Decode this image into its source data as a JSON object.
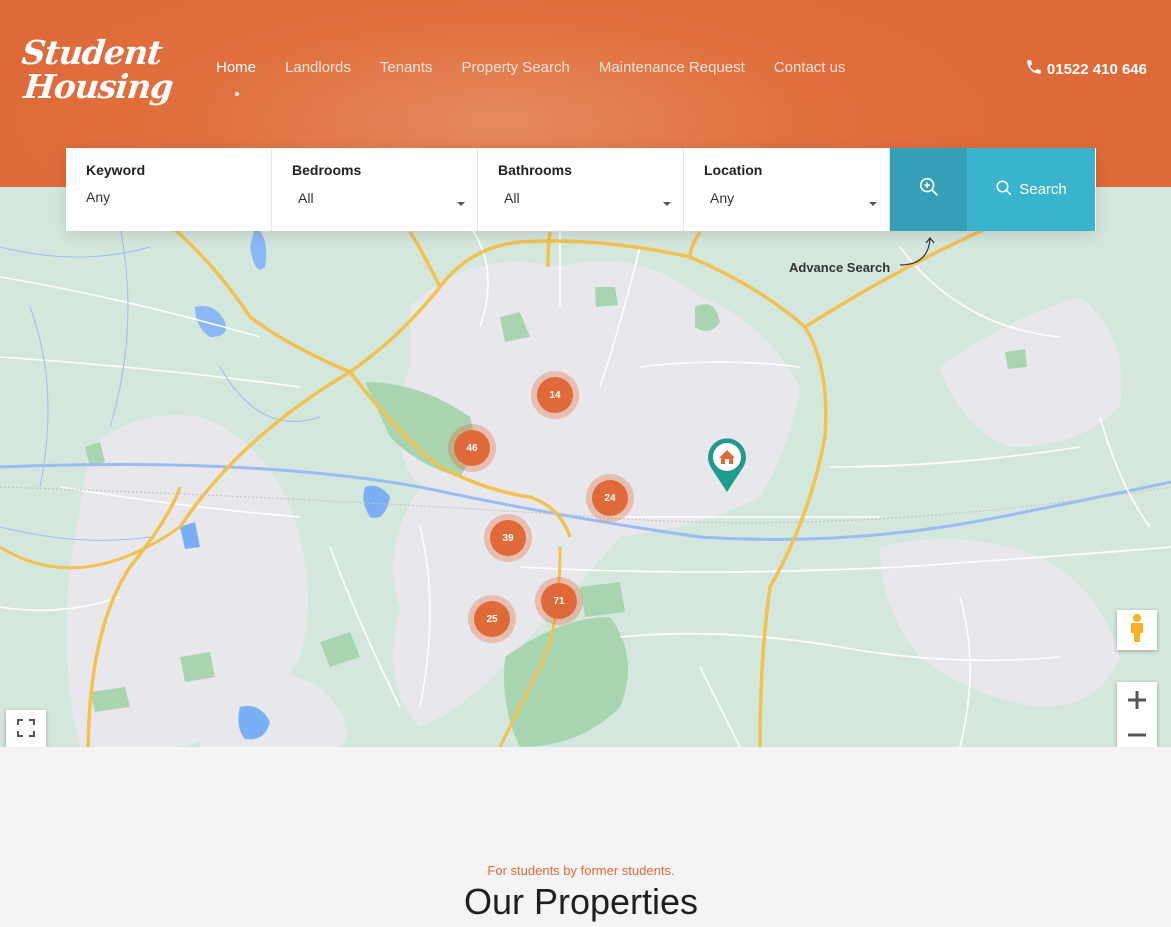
{
  "brand": {
    "line1": "Student",
    "line2": "Housing",
    "color": "#e0693a"
  },
  "nav": {
    "items": [
      "Home",
      "Landlords",
      "Tenants",
      "Property Search",
      "Maintenance Request",
      "Contact us"
    ],
    "active": "Home"
  },
  "phone": {
    "icon": "phone-icon",
    "number": "01522 410 646"
  },
  "search": {
    "keyword": {
      "label": "Keyword",
      "value": "Any"
    },
    "bedrooms": {
      "label": "Bedrooms",
      "value": "All"
    },
    "bathrooms": {
      "label": "Bathrooms",
      "value": "All"
    },
    "location": {
      "label": "Location",
      "value": "Any"
    },
    "advanced_icon": "zoom-in-icon",
    "search_label": "Search",
    "advanced_label": "Advance Search",
    "accent": "#3ab3cf"
  },
  "map": {
    "clusters": [
      "14",
      "46",
      "24",
      "39",
      "71",
      "25"
    ],
    "property_pin_icon": "home-pin-icon"
  },
  "section": {
    "tagline": "For students by former students.",
    "title": "Our Properties"
  }
}
